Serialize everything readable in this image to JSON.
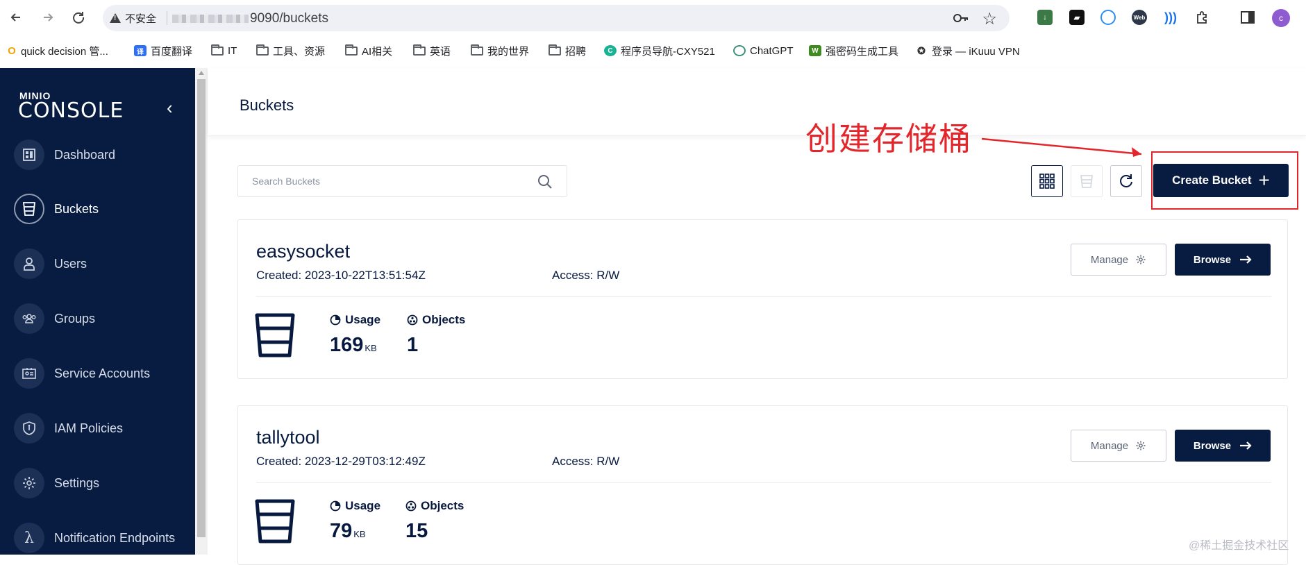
{
  "browser": {
    "security_label": "不安全",
    "url": "9090/buckets",
    "profile_initial": "c"
  },
  "bookmarks": [
    {
      "label": "quick decision 管...",
      "icon": "quick-decision-icon"
    },
    {
      "label": "百度翻译",
      "icon": "baidu-translate-icon"
    },
    {
      "label": "IT",
      "icon": "folder-icon"
    },
    {
      "label": "工具、资源",
      "icon": "folder-icon"
    },
    {
      "label": "AI相关",
      "icon": "folder-icon"
    },
    {
      "label": "英语",
      "icon": "folder-icon"
    },
    {
      "label": "我的世界",
      "icon": "folder-icon"
    },
    {
      "label": "招聘",
      "icon": "folder-icon"
    },
    {
      "label": "程序员导航-CXY521",
      "icon": "cxy-icon"
    },
    {
      "label": "ChatGPT",
      "icon": "chatgpt-icon"
    },
    {
      "label": "强密码生成工具",
      "icon": "password-tool-icon"
    },
    {
      "label": "登录 — iKuuu VPN",
      "icon": "vpn-icon"
    }
  ],
  "sidebar": {
    "logo_small": "MINIO",
    "logo_main": "CONSOLE",
    "items": [
      {
        "label": "Dashboard"
      },
      {
        "label": "Buckets"
      },
      {
        "label": "Users"
      },
      {
        "label": "Groups"
      },
      {
        "label": "Service Accounts"
      },
      {
        "label": "IAM Policies"
      },
      {
        "label": "Settings"
      },
      {
        "label": "Notification Endpoints"
      }
    ]
  },
  "header": {
    "title": "Buckets"
  },
  "annotation": {
    "text": "创建存储桶",
    "color": "#e3262b"
  },
  "toolbar": {
    "search_placeholder": "Search Buckets",
    "create_label": "Create Bucket"
  },
  "buckets": [
    {
      "name": "easysocket",
      "created": "Created: 2023-10-22T13:51:54Z",
      "access": "Access: R/W",
      "manage_label": "Manage",
      "browse_label": "Browse",
      "usage_label": "Usage",
      "usage_value": "169",
      "usage_unit": "KB",
      "objects_label": "Objects",
      "objects_value": "1"
    },
    {
      "name": "tallytool",
      "created": "Created: 2023-12-29T03:12:49Z",
      "access": "Access: R/W",
      "manage_label": "Manage",
      "browse_label": "Browse",
      "usage_label": "Usage",
      "usage_value": "79",
      "usage_unit": "KB",
      "objects_label": "Objects",
      "objects_value": "15"
    }
  ],
  "watermark": "@稀土掘金技术社区",
  "colors": {
    "sidebar_bg": "#081c42",
    "primary": "#081c42",
    "text": "#07193e"
  }
}
